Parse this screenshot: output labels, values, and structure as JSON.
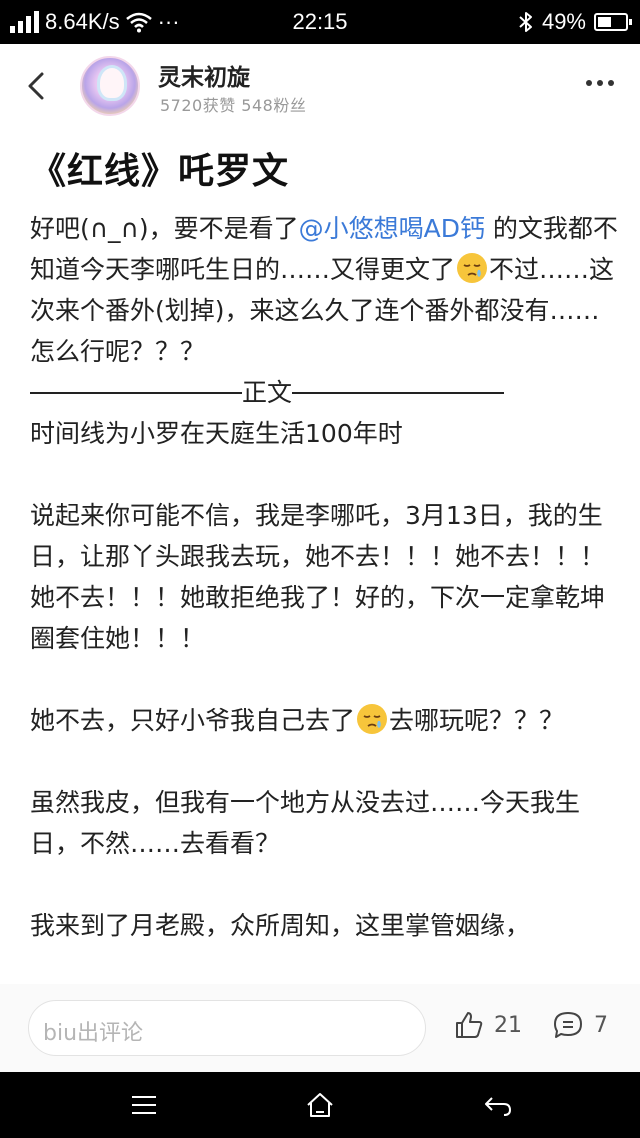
{
  "status_bar": {
    "network_speed": "8.64K/s",
    "more_dots": "···",
    "time": "22:15",
    "battery_percent": "49%",
    "battery_level": 0.49,
    "bluetooth_icon": "bluetooth-icon",
    "wifi_icon": "wifi-icon"
  },
  "header": {
    "author_name": "灵末初旋",
    "author_stats": "5720获赞  548粉丝"
  },
  "article": {
    "title": "《红线》吒罗文",
    "p1_a": "好吧(∩_∩)，要不是看了",
    "p1_mention": "@小悠想喝AD钙",
    "p1_b": " 的文我都不知道今天李哪吒生日的……又得更文了",
    "p1_c": "不过……这次来个番外(划掉)，来这么久了连个番外都没有……怎么行呢？？？",
    "divider_label": "正文",
    "p2": "时间线为小罗在天庭生活100年时",
    "p3": "说起来你可能不信，我是李哪吒，3月13日，我的生日，让那丫头跟我去玩，她不去！！！她不去！！！她不去！！！她敢拒绝我了！好的，下次一定拿乾坤圈套住她！！！",
    "p4_a": "她不去，只好小爷我自己去了",
    "p4_b": "去哪玩呢？？？",
    "p5": "虽然我皮，但我有一个地方从没去过……今天我生日，不然……去看看？",
    "p6": "我来到了月老殿，众所周知，这里掌管姻缘，"
  },
  "comment_bar": {
    "placeholder": "biu出评论",
    "like_count": "21",
    "comment_count": "7"
  },
  "colors": {
    "mention": "#3b7ad8",
    "status_bar_bg": "#000000",
    "nav_bar_bg": "#000000"
  },
  "icons": {
    "back": "back-arrow-icon",
    "more": "more-dots-icon",
    "emoji": "sleepy-face-emoji-icon",
    "like": "thumbs-up-icon",
    "comment": "comment-bubble-icon",
    "nav_menu": "menu-icon",
    "nav_home": "home-icon",
    "nav_back": "nav-back-icon"
  }
}
